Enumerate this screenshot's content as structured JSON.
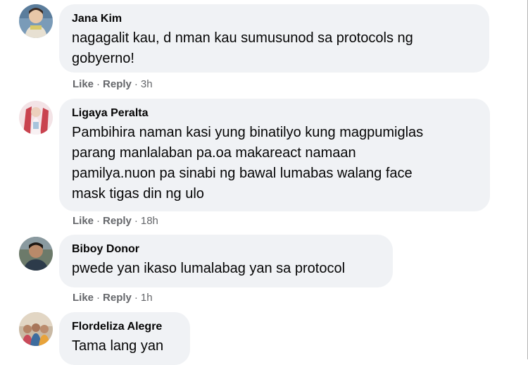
{
  "comments": [
    {
      "author": "Jana Kim",
      "text": "nagagalit kau, d nman kau sumusunod sa protocols ng\ngobyerno!",
      "like": "Like",
      "reply": "Reply",
      "separator": "·",
      "time": "3h"
    },
    {
      "author": "Ligaya Peralta",
      "text": "Pambihira naman kasi yung binatilyo kung magpumiglas\nparang manlalaban pa.oa makareact namaan\npamilya.nuon pa sinabi ng bawal lumabas walang face\nmask tigas din ng ulo",
      "like": "Like",
      "reply": "Reply",
      "separator": "·",
      "time": "18h"
    },
    {
      "author": "Biboy Donor",
      "text": "pwede yan ikaso lumalabag yan sa protocol",
      "like": "Like",
      "reply": "Reply",
      "separator": "·",
      "time": "1h"
    },
    {
      "author": "Flordeliza Alegre",
      "text": "Tama lang yan"
    }
  ]
}
